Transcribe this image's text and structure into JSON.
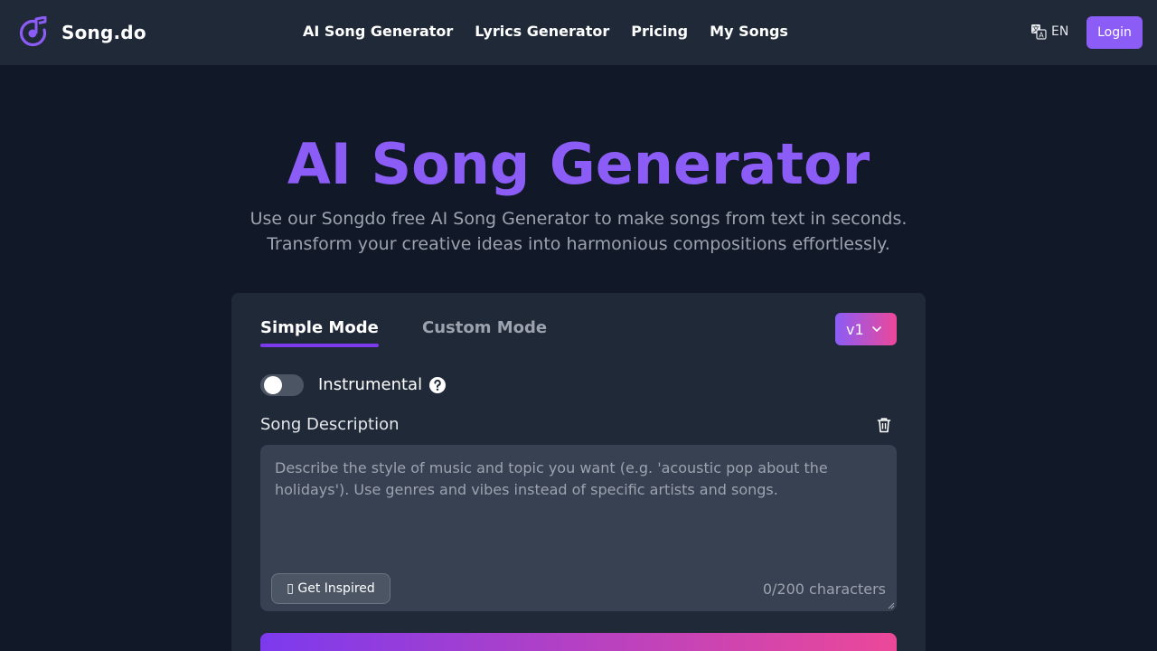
{
  "header": {
    "brand": "Song.do",
    "nav": [
      "AI Song Generator",
      "Lyrics Generator",
      "Pricing",
      "My Songs"
    ],
    "language": "EN",
    "login": "Login"
  },
  "hero": {
    "title": "AI Song Generator",
    "subtitle_line1": "Use our Songdo free AI Song Generator to make songs from text in seconds.",
    "subtitle_line2": "Transform your creative ideas into harmonious compositions effortlessly."
  },
  "form": {
    "tabs": [
      "Simple Mode",
      "Custom Mode"
    ],
    "active_tab": "Simple Mode",
    "version": "v1",
    "instrumental_label": "Instrumental",
    "instrumental_on": false,
    "description_label": "Song Description",
    "description_value": "",
    "description_placeholder": "Describe the style of music and topic you want (e.g. 'acoustic pop about the holidays'). Use genres and vibes instead of specific artists and songs.",
    "inspire_button": "▯ Get Inspired",
    "char_count": "0/200 characters"
  },
  "colors": {
    "accent": "#8b5cf6",
    "gradient_end": "#ec4899",
    "background": "#111827",
    "panel": "#1f2937"
  },
  "icons": [
    "music-note-logo-icon",
    "translate-icon",
    "chevron-down-icon",
    "help-circle-icon",
    "trash-icon",
    "resize-handle-icon"
  ]
}
